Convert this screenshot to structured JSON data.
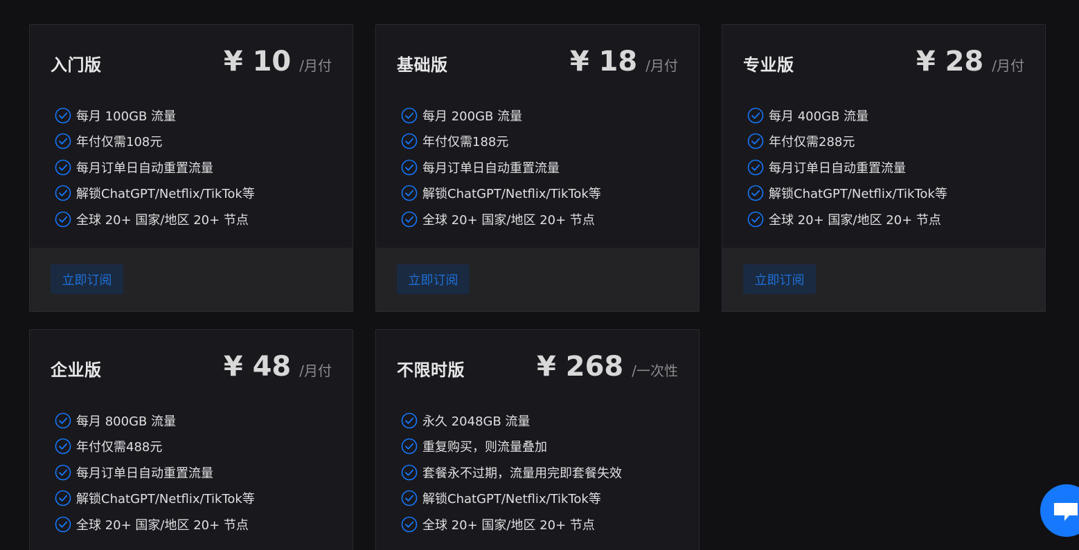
{
  "colors": {
    "page_background": "#111113",
    "card_background": "#18181d",
    "footer_background": "#232326",
    "accent": "#1677ff",
    "button_text": "#1f6fd6"
  },
  "plans": [
    {
      "name": "入门版",
      "price": "¥ 10",
      "period": "/月付",
      "features": [
        "每月 100GB 流量",
        "年付仅需108元",
        "每月订单日自动重置流量",
        "解锁ChatGPT/Netflix/TikTok等",
        "全球 20+ 国家/地区 20+ 节点"
      ],
      "button": "立即订阅"
    },
    {
      "name": "基础版",
      "price": "¥ 18",
      "period": "/月付",
      "features": [
        "每月 200GB 流量",
        "年付仅需188元",
        "每月订单日自动重置流量",
        "解锁ChatGPT/Netflix/TikTok等",
        "全球 20+ 国家/地区 20+ 节点"
      ],
      "button": "立即订阅"
    },
    {
      "name": "专业版",
      "price": "¥ 28",
      "period": "/月付",
      "features": [
        "每月 400GB 流量",
        "年付仅需288元",
        "每月订单日自动重置流量",
        "解锁ChatGPT/Netflix/TikTok等",
        "全球 20+ 国家/地区 20+ 节点"
      ],
      "button": "立即订阅"
    },
    {
      "name": "企业版",
      "price": "¥ 48",
      "period": "/月付",
      "features": [
        "每月 800GB 流量",
        "年付仅需488元",
        "每月订单日自动重置流量",
        "解锁ChatGPT/Netflix/TikTok等",
        "全球 20+ 国家/地区 20+ 节点"
      ]
    },
    {
      "name": "不限时版",
      "price": "¥ 268",
      "period": "/一次性",
      "features": [
        "永久 2048GB 流量",
        "重复购买，则流量叠加",
        "套餐永不过期，流量用完即套餐失效",
        "解锁ChatGPT/Netflix/TikTok等",
        "全球 20+ 国家/地区 20+ 节点"
      ]
    }
  ],
  "icons": {
    "feature_check": "check-circle-icon",
    "chat_button": "chat-bubble-icon"
  }
}
